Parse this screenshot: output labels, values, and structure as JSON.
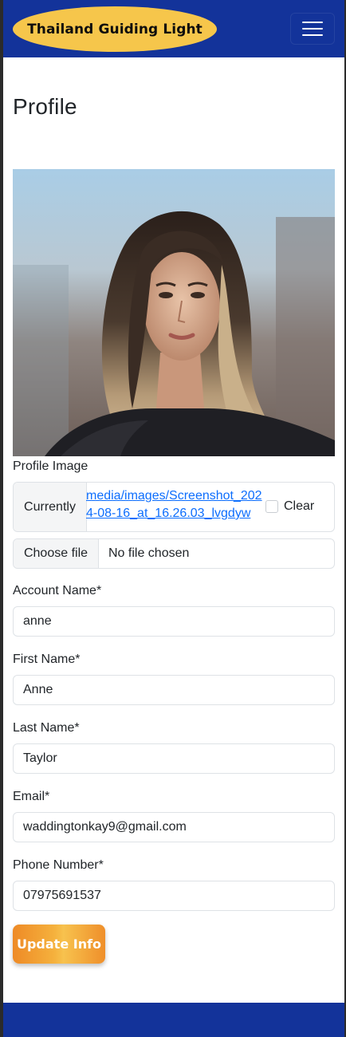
{
  "navbar": {
    "brand": "Thailand Guiding Light",
    "menu_icon": "hamburger-menu-icon",
    "bg_color": "#13339a",
    "brand_color": "#f6c64b"
  },
  "page": {
    "title": "Profile"
  },
  "form": {
    "profile_image_label": "Profile Image",
    "current_label": "Currently",
    "current_file": "media/images/Screenshot_2024-08-16_at_16.26.03_lvgdyw",
    "clear_label": "Clear",
    "choose_file_label": "Choose file",
    "file_status": "No file chosen",
    "account_name_label": "Account Name*",
    "account_name_value": "anne",
    "first_name_label": "First Name*",
    "first_name_value": "Anne",
    "last_name_label": "Last Name*",
    "last_name_value": "Taylor",
    "email_label": "Email*",
    "email_value": "waddingtonkay9@gmail.com",
    "phone_label": "Phone Number*",
    "phone_value": "07975691537",
    "submit_label": "Update Info"
  },
  "colors": {
    "link": "#0d6efd",
    "button_gradient": [
      "#ee8a26",
      "#f7c24e"
    ]
  }
}
